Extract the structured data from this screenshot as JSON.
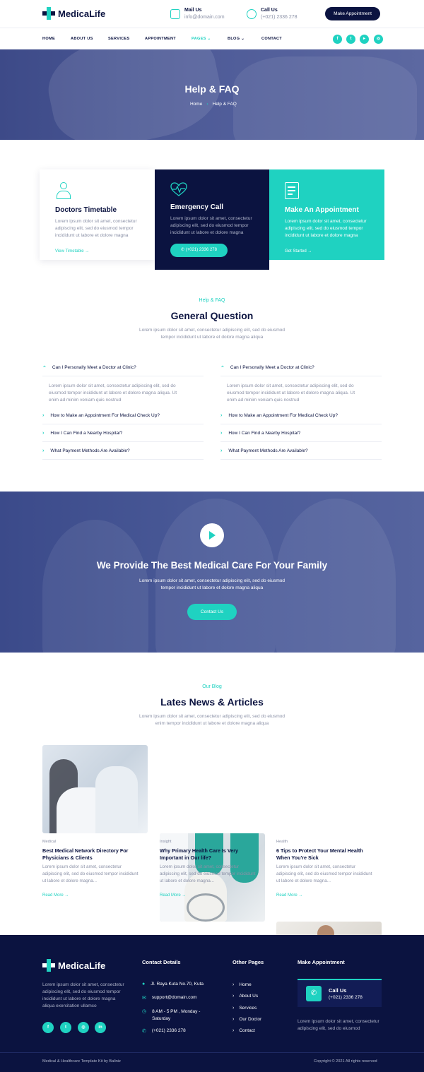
{
  "brand": {
    "name": "MedicaLife"
  },
  "header": {
    "mail": {
      "label": "Mail Us",
      "value": "info@domain.com"
    },
    "call": {
      "label": "Call Us",
      "value": "(+021) 2336 278"
    },
    "cta_button": "Make Appointment",
    "nav": [
      "HOME",
      "ABOUT US",
      "SERVICES",
      "APPOINTMENT",
      "PAGES",
      "BLOG",
      "CONTACT"
    ],
    "nav_active": "PAGES",
    "social_icons": [
      "facebook-icon",
      "twitter-icon",
      "youtube-icon",
      "instagram-icon"
    ]
  },
  "hero": {
    "title": "Help & FAQ",
    "breadcrumb": [
      "Home",
      "Help & FAQ"
    ]
  },
  "services": [
    {
      "icon": "doctor-icon",
      "title": "Doctors Timetable",
      "text": "Lorem ipsum dolor sit amet, consectetur adipiscing elit, sed do eiusmod tempor incididunt ut labore et dolore magna",
      "link": "View Timetable"
    },
    {
      "icon": "heartbeat-icon",
      "title": "Emergency Call",
      "text": "Lorem ipsum dolor sit amet, consectetur adipiscing elit, sed do eiusmod tempor incididunt ut labore et dolore magna",
      "button": "(+021) 2336 278"
    },
    {
      "icon": "clipboard-icon",
      "title": "Make An Appointment",
      "text": "Lorem ipsum dolor sit amet, consectetur adipiscing elit, sed do eiusmod tempor incididunt ut labore et dolore magna",
      "link": "Get Started"
    }
  ],
  "faq": {
    "eyebrow": "Help & FAQ",
    "title": "General Question",
    "subtitle_1": "Lorem ipsum dolor sit amet, consectetur adipiscing elit, sed do eiusmod",
    "subtitle_2": "tempor incididunt ut labore et dolore magna aliqua",
    "left": {
      "open_question": "Can I Personally Meet a Doctor at Clinic?",
      "answer_1": "Lorem ipsum dolor sit amet, consectetur adipiscing elit, sed do",
      "answer_2": "eiusmod tempor incididunt ut labore et dolore magna aliqua. Ut",
      "answer_3": "enim ad minim veniam quis nostrud",
      "questions": [
        "How to Make an Appointment For Medical Check Up?",
        "How I Can Find a Nearby Hospital?",
        "What Payment Methods Are Available?"
      ]
    },
    "right": {
      "open_question": "Can I Personally Meet a Doctor at Clinic?",
      "answer_1": "Lorem ipsum dolor sit amet, consectetur adipiscing elit, sed do",
      "answer_2": "eiusmod tempor incididunt ut labore et dolore magna aliqua. Ut",
      "answer_3": "enim ad minim veniam quis nostrud",
      "questions": [
        "How to Make an Appointment For Medical Check Up?",
        "How I Can Find a Nearby Hospital?",
        "What Payment Methods Are Available?"
      ]
    }
  },
  "cta": {
    "title": "We Provide The Best Medical Care For Your Family",
    "sub_1": "Lorem ipsum dolor sit amet, consectetur adipiscing elit, sed do eiusmod",
    "sub_2": "tempor incididunt ut labore et dolore magna aliqua",
    "button": "Contact Us"
  },
  "blog": {
    "eyebrow": "Our Blog",
    "title": "Lates News & Articles",
    "subtitle_1": "Lorem ipsum dolor sit amet, consectetur adipiscing elit, sed do eiusmod",
    "subtitle_2": "enim tempor incididunt ut labore et dolore magna aliqua",
    "posts": [
      {
        "category": "Medical",
        "title_1": "Best Medical Network Directory For",
        "title_2": "Physicians & Clients",
        "text_1": "Lorem ipsum dolor sit amet, consectetur",
        "text_2": "adipiscing elit, sed do eiusmod tempor incididunt",
        "text_3": "ut labore et dolore magna...",
        "link": "Read More"
      },
      {
        "category": "Insight",
        "title_1": "Why Primary Health Care Is Very",
        "title_2": "Important in Our life?",
        "text_1": "Lorem ipsum dolor sit amet, consectetur",
        "text_2": "adipiscing elit, sed do eiusmod tempor incididunt",
        "text_3": "ut labore et dolore magna...",
        "link": "Read More"
      },
      {
        "category": "Health",
        "title_1": "6 Tips to Protect Your Mental Health",
        "title_2": "When You're Sick",
        "text_1": "Lorem ipsum dolor sit amet, consectetur",
        "text_2": "adipiscing elit, sed do eiusmod tempor incididunt",
        "text_3": "ut labore et dolore magna...",
        "link": "Read More"
      }
    ]
  },
  "footer": {
    "about_1": "Lorem ipsum dolor sit amet, consectetur",
    "about_2": "adipiscing elit, sed do eiusmod tempor",
    "about_3": "incididunt ut labore et dolore magna",
    "about_4": "aliqua exercitation ullamco",
    "contact_title": "Contact Details",
    "address": "Jl. Raya Kuta No.70, Kuta",
    "email": "support@domain.com",
    "hours_1": "8 AM - 5 PM , Monday -",
    "hours_2": "Saturday",
    "phone": "(+021) 2336 278",
    "pages_title": "Other Pages",
    "pages": [
      "Home",
      "About Us",
      "Services",
      "Our Doctor",
      "Contact"
    ],
    "appointment_title": "Make Appointment",
    "call_label": "Call Us",
    "call_value": "(+021) 2336 278",
    "appointment_text_1": "Lorem ipsum dolor sit amet, consectetur",
    "appointment_text_2": "adipiscing elit, sed do eiusmod",
    "credit": "Medical & Healthcare Template Kit by Baliniz",
    "copyright": "Copyright © 2021 All rights reserved"
  },
  "colors": {
    "navy": "#0b1340",
    "teal": "#1fd2c1",
    "muted": "#8a90a6"
  }
}
